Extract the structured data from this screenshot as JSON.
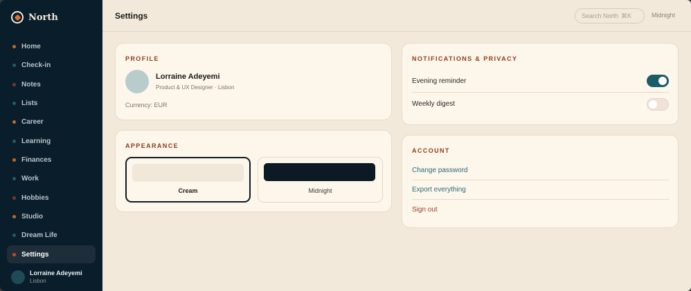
{
  "brand": {
    "name": "North"
  },
  "sidebar": {
    "items": [
      {
        "label": "Home",
        "dot": "#c2692b"
      },
      {
        "label": "Check-in",
        "dot": "#1f5d6a"
      },
      {
        "label": "Notes",
        "dot": "#7a3a28"
      },
      {
        "label": "Lists",
        "dot": "#1f5d6a"
      },
      {
        "label": "Career",
        "dot": "#c2692b"
      },
      {
        "label": "Learning",
        "dot": "#1f5d6a"
      },
      {
        "label": "Finances",
        "dot": "#c2692b"
      },
      {
        "label": "Work",
        "dot": "#1f5d6a"
      },
      {
        "label": "Hobbies",
        "dot": "#7a3a28"
      },
      {
        "label": "Studio",
        "dot": "#c2692b"
      },
      {
        "label": "Dream Life",
        "dot": "#1f5d6a"
      },
      {
        "label": "Settings",
        "dot": "#d0452a",
        "active": true
      }
    ],
    "user": {
      "name": "Lorraine Adeyemi",
      "location": "Lisbon"
    }
  },
  "header": {
    "title": "Settings",
    "search_placeholder": "Search North",
    "search_shortcut": "⌘K",
    "theme_label": "Midnight"
  },
  "profile": {
    "section_title": "PROFILE",
    "name": "Lorraine Adeyemi",
    "role": "Product & UX Designer · Lisbon",
    "currency": "Currency: EUR"
  },
  "appearance": {
    "section_title": "APPEARANCE",
    "options": [
      {
        "label": "Cream",
        "color": "#f1e8d9",
        "selected": true
      },
      {
        "label": "Midnight",
        "color": "#0c1a24",
        "selected": false
      }
    ]
  },
  "notifications": {
    "section_title": "NOTIFICATIONS & PRIVACY",
    "toggles": [
      {
        "label": "Evening reminder",
        "on": true
      },
      {
        "label": "Weekly digest",
        "on": false
      }
    ]
  },
  "account": {
    "section_title": "ACCOUNT",
    "links": [
      "Change password",
      "Export everything",
      "Sign out"
    ]
  },
  "colors": {
    "sidebar_bg": "#0a1d2a",
    "page_bg": "#f2e9da",
    "card_bg": "#fdf6ea",
    "accent_teal": "#1a5c68",
    "section_title": "#8c3d1f",
    "danger": "#9a3f2a"
  }
}
